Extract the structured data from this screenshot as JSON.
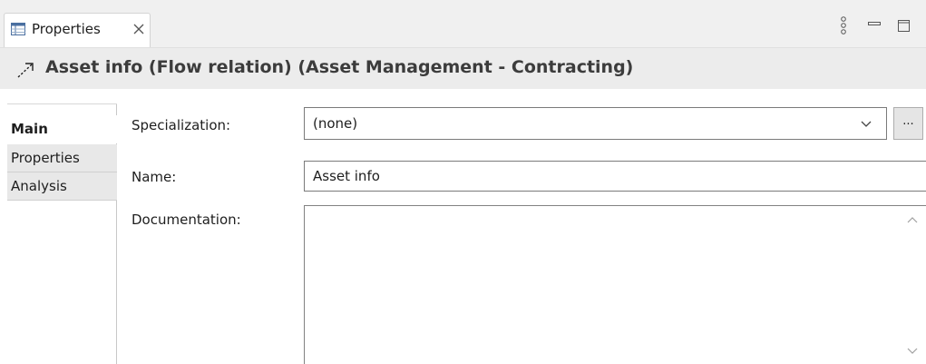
{
  "view_tab": {
    "label": "Properties",
    "icon": "properties-table-icon",
    "close_icon": "close-icon"
  },
  "view_toolbar": {
    "menu_icon": "view-menu-icon",
    "minimize_icon": "minimize-icon",
    "maximize_icon": "maximize-icon"
  },
  "header": {
    "icon": "flow-relation-icon",
    "title": "Asset info (Flow relation) (Asset Management - Contracting)"
  },
  "side_tabs": [
    {
      "label": "Main",
      "active": true
    },
    {
      "label": "Properties",
      "active": false
    },
    {
      "label": "Analysis",
      "active": false
    }
  ],
  "form": {
    "specialization_label": "Specialization:",
    "specialization_value": "(none)",
    "specialization_button": "...",
    "name_label": "Name:",
    "name_value": "Asset info",
    "documentation_label": "Documentation:",
    "documentation_value": ""
  },
  "colors": {
    "tabbar_bg": "#f0f0f0",
    "titlebar_bg": "#ececec",
    "inactive_tab_bg": "#e8e8e8",
    "title_text": "#3c3c3c"
  }
}
